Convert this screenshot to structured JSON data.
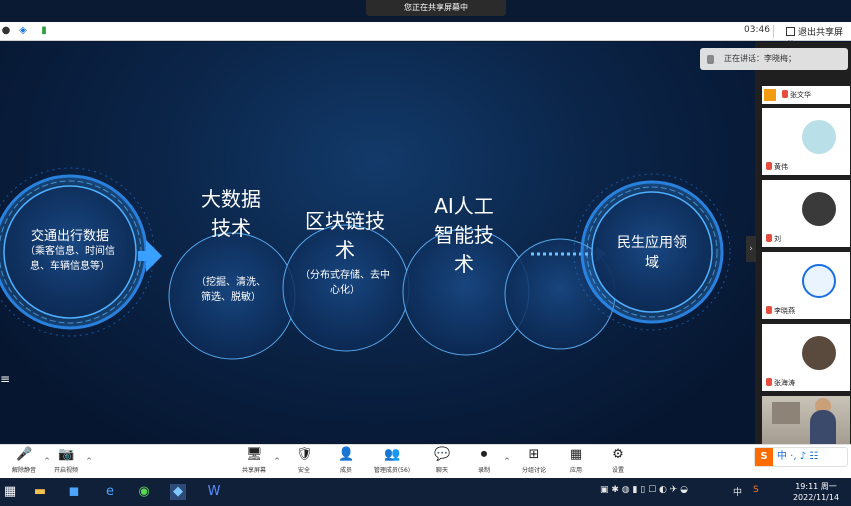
{
  "window": {
    "share_banner": "您正在共享屏幕中"
  },
  "topbar": {
    "time": "03:46",
    "exit_label": "退出共享屏幕"
  },
  "slide": {
    "circles": [
      {
        "title": "交通出行数据",
        "subtitle": "（乘客信息、时间信息、车辆信息等）"
      },
      {
        "title": "大数据技术",
        "subtitle": "（挖掘、清洗、筛选、脱敏）"
      },
      {
        "title": "区块链技术",
        "subtitle": "（分布式存储、去中心化）"
      },
      {
        "title": "AI人工智能技术",
        "subtitle": ""
      },
      {
        "title": "",
        "subtitle": ""
      },
      {
        "title": "民生应用领域",
        "subtitle": ""
      }
    ],
    "side_mark": "≡"
  },
  "panel": {
    "speaking": "正在讲话：李晓梅；",
    "participants": [
      {
        "name": "张文华"
      },
      {
        "name": "黄伟"
      },
      {
        "name": "刘"
      },
      {
        "name": "李晓燕"
      },
      {
        "name": "张海涛"
      }
    ],
    "toggle": "›"
  },
  "controls": {
    "items": [
      {
        "label": "解除静音",
        "icon": "mic-off-icon",
        "glyph": "🎤"
      },
      {
        "label": "开启视频",
        "icon": "camera-off-icon",
        "glyph": "📷"
      },
      {
        "label": "共享屏幕",
        "icon": "share-screen-icon",
        "glyph": "🖥"
      },
      {
        "label": "安全",
        "icon": "shield-icon",
        "glyph": "🛡"
      },
      {
        "label": "成员",
        "icon": "member-icon",
        "glyph": "👤"
      },
      {
        "label": "管理成员(56)",
        "icon": "manage-members-icon",
        "glyph": "👥"
      },
      {
        "label": "聊天",
        "icon": "chat-icon",
        "glyph": "💬"
      },
      {
        "label": "录制",
        "icon": "record-icon",
        "glyph": "⏺"
      },
      {
        "label": "分组讨论",
        "icon": "breakout-icon",
        "glyph": "⊞"
      },
      {
        "label": "应用",
        "icon": "apps-icon",
        "glyph": "▦"
      },
      {
        "label": "设置",
        "icon": "gear-icon",
        "glyph": "⚙"
      }
    ],
    "ime": {
      "logo": "S",
      "text": "中 ·, ♪ ☷"
    }
  },
  "taskbar": {
    "tray_text": "中",
    "clock_time": "19:11 周一",
    "clock_date": "2022/11/14"
  },
  "colors": {
    "slide_bg": "#0b2549",
    "accent": "#3aa0ff",
    "ime_orange": "#ff6b00"
  }
}
